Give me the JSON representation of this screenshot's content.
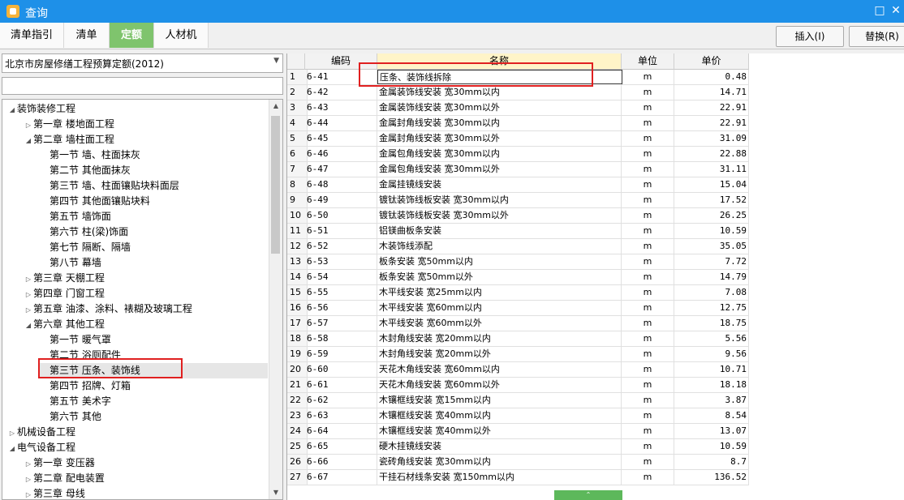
{
  "window": {
    "title": "查询",
    "maximize_label": "□",
    "close_label": "✕"
  },
  "tabs": [
    {
      "label": "清单指引"
    },
    {
      "label": "清单"
    },
    {
      "label": "定额"
    },
    {
      "label": "人材机"
    }
  ],
  "toolbar": {
    "insert_label": "插入(I)",
    "replace_label": "替换(R)"
  },
  "left": {
    "library": "北京市房屋修缮工程预算定额(2012)",
    "search_value": "",
    "tree": [
      {
        "label": "装饰装修工程",
        "exp": "◢"
      },
      {
        "label": "第一章 楼地面工程",
        "exp": "▷"
      },
      {
        "label": "第二章 墙柱面工程",
        "exp": "◢"
      },
      {
        "label": "第一节 墙、柱面抹灰",
        "exp": ""
      },
      {
        "label": "第二节 其他面抹灰",
        "exp": ""
      },
      {
        "label": "第三节 墙、柱面镶贴块料面层",
        "exp": ""
      },
      {
        "label": "第四节 其他面镶贴块料",
        "exp": ""
      },
      {
        "label": "第五节 墙饰面",
        "exp": ""
      },
      {
        "label": "第六节 柱(梁)饰面",
        "exp": ""
      },
      {
        "label": "第七节 隔断、隔墙",
        "exp": ""
      },
      {
        "label": "第八节 幕墙",
        "exp": ""
      },
      {
        "label": "第三章 天棚工程",
        "exp": "▷"
      },
      {
        "label": "第四章 门窗工程",
        "exp": "▷"
      },
      {
        "label": "第五章 油漆、涂料、裱糊及玻璃工程",
        "exp": "▷"
      },
      {
        "label": "第六章 其他工程",
        "exp": "◢"
      },
      {
        "label": "第一节 暖气罩",
        "exp": ""
      },
      {
        "label": "第二节 浴厕配件",
        "exp": ""
      },
      {
        "label": "第三节 压条、装饰线",
        "exp": ""
      },
      {
        "label": "第四节 招牌、灯箱",
        "exp": ""
      },
      {
        "label": "第五节 美术字",
        "exp": ""
      },
      {
        "label": "第六节 其他",
        "exp": ""
      },
      {
        "label": "机械设备工程",
        "exp": "▷"
      },
      {
        "label": "电气设备工程",
        "exp": "◢"
      },
      {
        "label": "第一章 变压器",
        "exp": "▷"
      },
      {
        "label": "第二章 配电装置",
        "exp": "▷"
      },
      {
        "label": "第三章 母线",
        "exp": "▷"
      }
    ]
  },
  "table": {
    "headers": {
      "code": "编码",
      "name": "名称",
      "unit": "单位",
      "price": "单价"
    },
    "rows": [
      {
        "idx": "1",
        "code": "6-41",
        "name": "压条、装饰线拆除",
        "unit": "m",
        "price": "0.48"
      },
      {
        "idx": "2",
        "code": "6-42",
        "name": "金属装饰线安装 宽30mm以内",
        "unit": "m",
        "price": "14.71"
      },
      {
        "idx": "3",
        "code": "6-43",
        "name": "金属装饰线安装 宽30mm以外",
        "unit": "m",
        "price": "22.91"
      },
      {
        "idx": "4",
        "code": "6-44",
        "name": "金属封角线安装 宽30mm以内",
        "unit": "m",
        "price": "22.91"
      },
      {
        "idx": "5",
        "code": "6-45",
        "name": "金属封角线安装 宽30mm以外",
        "unit": "m",
        "price": "31.09"
      },
      {
        "idx": "6",
        "code": "6-46",
        "name": "金属包角线安装 宽30mm以内",
        "unit": "m",
        "price": "22.88"
      },
      {
        "idx": "7",
        "code": "6-47",
        "name": "金属包角线安装 宽30mm以外",
        "unit": "m",
        "price": "31.11"
      },
      {
        "idx": "8",
        "code": "6-48",
        "name": "金属挂镜线安装",
        "unit": "m",
        "price": "15.04"
      },
      {
        "idx": "9",
        "code": "6-49",
        "name": "镀钛装饰线板安装 宽30mm以内",
        "unit": "m",
        "price": "17.52"
      },
      {
        "idx": "10",
        "code": "6-50",
        "name": "镀钛装饰线板安装 宽30mm以外",
        "unit": "m",
        "price": "26.25"
      },
      {
        "idx": "11",
        "code": "6-51",
        "name": "铝镁曲板条安装",
        "unit": "m",
        "price": "10.59"
      },
      {
        "idx": "12",
        "code": "6-52",
        "name": "木装饰线添配",
        "unit": "m",
        "price": "35.05"
      },
      {
        "idx": "13",
        "code": "6-53",
        "name": "板条安装 宽50mm以内",
        "unit": "m",
        "price": "7.72"
      },
      {
        "idx": "14",
        "code": "6-54",
        "name": "板条安装 宽50mm以外",
        "unit": "m",
        "price": "14.79"
      },
      {
        "idx": "15",
        "code": "6-55",
        "name": "木平线安装 宽25mm以内",
        "unit": "m",
        "price": "7.08"
      },
      {
        "idx": "16",
        "code": "6-56",
        "name": "木平线安装 宽60mm以内",
        "unit": "m",
        "price": "12.75"
      },
      {
        "idx": "17",
        "code": "6-57",
        "name": "木平线安装 宽60mm以外",
        "unit": "m",
        "price": "18.75"
      },
      {
        "idx": "18",
        "code": "6-58",
        "name": "木封角线安装 宽20mm以内",
        "unit": "m",
        "price": "5.56"
      },
      {
        "idx": "19",
        "code": "6-59",
        "name": "木封角线安装 宽20mm以外",
        "unit": "m",
        "price": "9.56"
      },
      {
        "idx": "20",
        "code": "6-60",
        "name": "天花木角线安装 宽60mm以内",
        "unit": "m",
        "price": "10.71"
      },
      {
        "idx": "21",
        "code": "6-61",
        "name": "天花木角线安装 宽60mm以外",
        "unit": "m",
        "price": "18.18"
      },
      {
        "idx": "22",
        "code": "6-62",
        "name": "木镶框线安装 宽15mm以内",
        "unit": "m",
        "price": "3.87"
      },
      {
        "idx": "23",
        "code": "6-63",
        "name": "木镶框线安装 宽40mm以内",
        "unit": "m",
        "price": "8.54"
      },
      {
        "idx": "24",
        "code": "6-64",
        "name": "木镶框线安装 宽40mm以外",
        "unit": "m",
        "price": "13.07"
      },
      {
        "idx": "25",
        "code": "6-65",
        "name": "硬木挂镜线安装",
        "unit": "m",
        "price": "10.59"
      },
      {
        "idx": "26",
        "code": "6-66",
        "name": "瓷砖角线安装 宽30mm以内",
        "unit": "m",
        "price": "8.7"
      },
      {
        "idx": "27",
        "code": "6-67",
        "name": "干挂石材线条安装 宽150mm以内",
        "unit": "m",
        "price": "136.52"
      }
    ]
  },
  "colors": {
    "titlebar": "#1e90e8",
    "active_tab": "#7fc46d",
    "highlight_box": "#e02020"
  }
}
